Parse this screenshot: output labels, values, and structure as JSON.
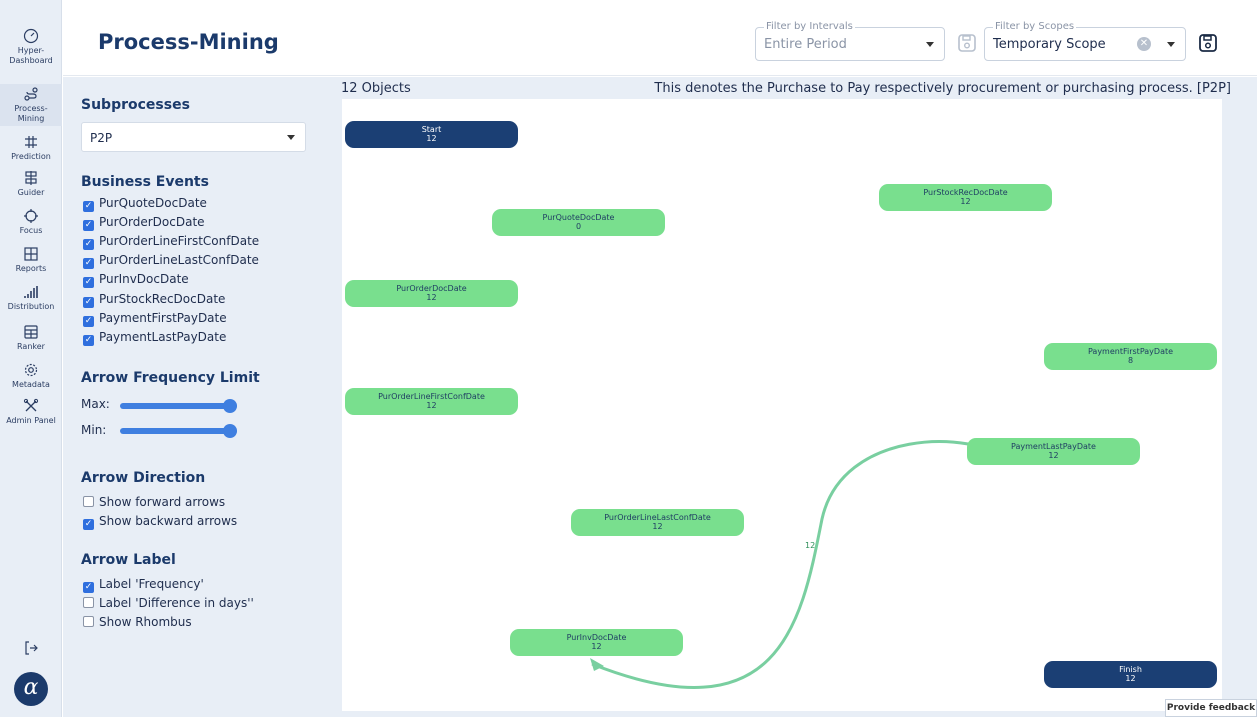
{
  "app": {
    "title": "Process-Mining"
  },
  "colors": {
    "accent": "#1b3a6b",
    "node_green": "#79df8e",
    "node_blue": "#1b3f74",
    "edge": "#79cfa0"
  },
  "sidebar": {
    "items": [
      {
        "label": "Hyper-Dashboard",
        "icon": "gauge-icon"
      },
      {
        "label": "Process-Mining",
        "icon": "process-icon",
        "active": true
      },
      {
        "label": "Prediction",
        "icon": "prediction-icon"
      },
      {
        "label": "Guider",
        "icon": "guider-icon"
      },
      {
        "label": "Focus",
        "icon": "crosshair-icon"
      },
      {
        "label": "Reports",
        "icon": "grid-icon"
      },
      {
        "label": "Distribution",
        "icon": "bars-icon"
      },
      {
        "label": "Ranker",
        "icon": "table-icon"
      },
      {
        "label": "Metadata",
        "icon": "gear-icon"
      },
      {
        "label": "Admin Panel",
        "icon": "tools-icon"
      }
    ],
    "logout_icon": "logout-icon",
    "logo_text": "α"
  },
  "header": {
    "intervals": {
      "legend": "Filter by Intervals",
      "value": "Entire Period"
    },
    "scopes": {
      "legend": "Filter by Scopes",
      "value": "Temporary Scope"
    }
  },
  "panel": {
    "subprocesses": {
      "title": "Subprocesses",
      "selected": "P2P"
    },
    "business_events": {
      "title": "Business Events",
      "items": [
        {
          "label": "PurQuoteDocDate",
          "checked": true
        },
        {
          "label": "PurOrderDocDate",
          "checked": true
        },
        {
          "label": "PurOrderLineFirstConfDate",
          "checked": true
        },
        {
          "label": "PurOrderLineLastConfDate",
          "checked": true
        },
        {
          "label": "PurInvDocDate",
          "checked": true
        },
        {
          "label": "PurStockRecDocDate",
          "checked": true
        },
        {
          "label": "PaymentFirstPayDate",
          "checked": true
        },
        {
          "label": "PaymentLastPayDate",
          "checked": true
        }
      ]
    },
    "arrow_frequency": {
      "title": "Arrow Frequency Limit",
      "max_label": "Max:",
      "min_label": "Min:",
      "max_value": 1.0,
      "min_value": 1.0
    },
    "arrow_direction": {
      "title": "Arrow Direction",
      "items": [
        {
          "label": "Show forward arrows",
          "checked": false
        },
        {
          "label": "Show backward arrows",
          "checked": true
        }
      ]
    },
    "arrow_label": {
      "title": "Arrow Label",
      "items": [
        {
          "label": "Label 'Frequency'",
          "checked": true
        },
        {
          "label": "Label 'Difference in days''",
          "checked": false
        },
        {
          "label": "Show Rhombus",
          "checked": false
        }
      ]
    }
  },
  "canvas": {
    "object_count": "12 Objects",
    "description": "This denotes the Purchase to Pay respectively procurement or purchasing process. [P2P]",
    "nodes": [
      {
        "id": "start",
        "label": "Start",
        "count": "12",
        "kind": "blue"
      },
      {
        "id": "pur-quote",
        "label": "PurQuoteDocDate",
        "count": "0",
        "kind": "green"
      },
      {
        "id": "pur-stock",
        "label": "PurStockRecDocDate",
        "count": "12",
        "kind": "green"
      },
      {
        "id": "pur-order",
        "label": "PurOrderDocDate",
        "count": "12",
        "kind": "green"
      },
      {
        "id": "payment-first",
        "label": "PaymentFirstPayDate",
        "count": "8",
        "kind": "green"
      },
      {
        "id": "pur-order-first",
        "label": "PurOrderLineFirstConfDate",
        "count": "12",
        "kind": "green"
      },
      {
        "id": "payment-last",
        "label": "PaymentLastPayDate",
        "count": "12",
        "kind": "green"
      },
      {
        "id": "pur-order-last",
        "label": "PurOrderLineLastConfDate",
        "count": "12",
        "kind": "green"
      },
      {
        "id": "pur-inv",
        "label": "PurInvDocDate",
        "count": "12",
        "kind": "green"
      },
      {
        "id": "finish",
        "label": "Finish",
        "count": "12",
        "kind": "blue"
      }
    ],
    "edges": [
      {
        "from": "payment-last",
        "to": "pur-inv",
        "label": "12"
      }
    ]
  },
  "feedback": {
    "label": "Provide feedback"
  }
}
